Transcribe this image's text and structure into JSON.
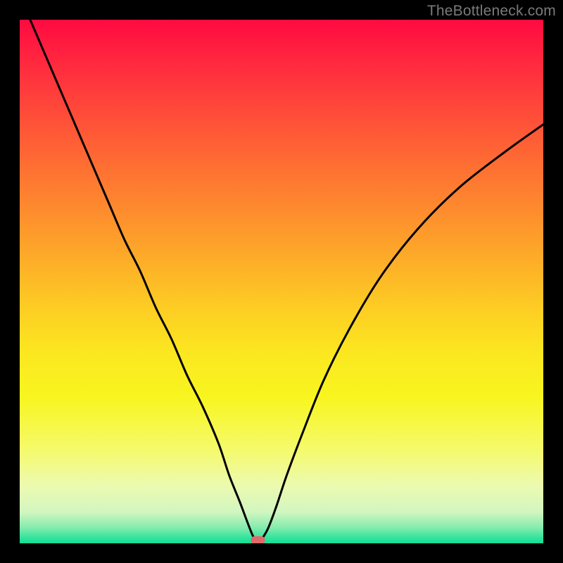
{
  "watermark": {
    "text": "TheBottleneck.com"
  },
  "chart_data": {
    "type": "line",
    "title": "",
    "xlabel": "",
    "ylabel": "",
    "xlim": [
      0,
      100
    ],
    "ylim": [
      0,
      100
    ],
    "grid": false,
    "legend": false,
    "background_gradient": {
      "direction": "top-to-bottom",
      "stops": [
        {
          "pos": 0,
          "color": "#ff0a40"
        },
        {
          "pos": 46,
          "color": "#fdad28"
        },
        {
          "pos": 72,
          "color": "#f8f51f"
        },
        {
          "pos": 100,
          "color": "#13df95"
        }
      ]
    },
    "series": [
      {
        "name": "bottleneck-curve",
        "x": [
          2,
          5,
          8,
          11,
          14,
          17,
          20,
          23,
          26,
          29,
          32,
          35,
          38,
          40,
          42,
          43.5,
          44.5,
          45.2,
          45.8,
          46.5,
          47.5,
          49,
          51,
          54,
          58,
          63,
          69,
          76,
          84,
          93,
          100
        ],
        "values": [
          100,
          93,
          86,
          79,
          72,
          65,
          58,
          52,
          45,
          39,
          32,
          26,
          19,
          13,
          8,
          4,
          1.5,
          0.5,
          0.5,
          1.2,
          3,
          7,
          13,
          21,
          31,
          41,
          51,
          60,
          68,
          75,
          80
        ]
      }
    ],
    "marker": {
      "name": "optimal-point",
      "x": 45.5,
      "y": 0.6,
      "shape": "rounded-rect",
      "color": "#e06a6a"
    }
  }
}
